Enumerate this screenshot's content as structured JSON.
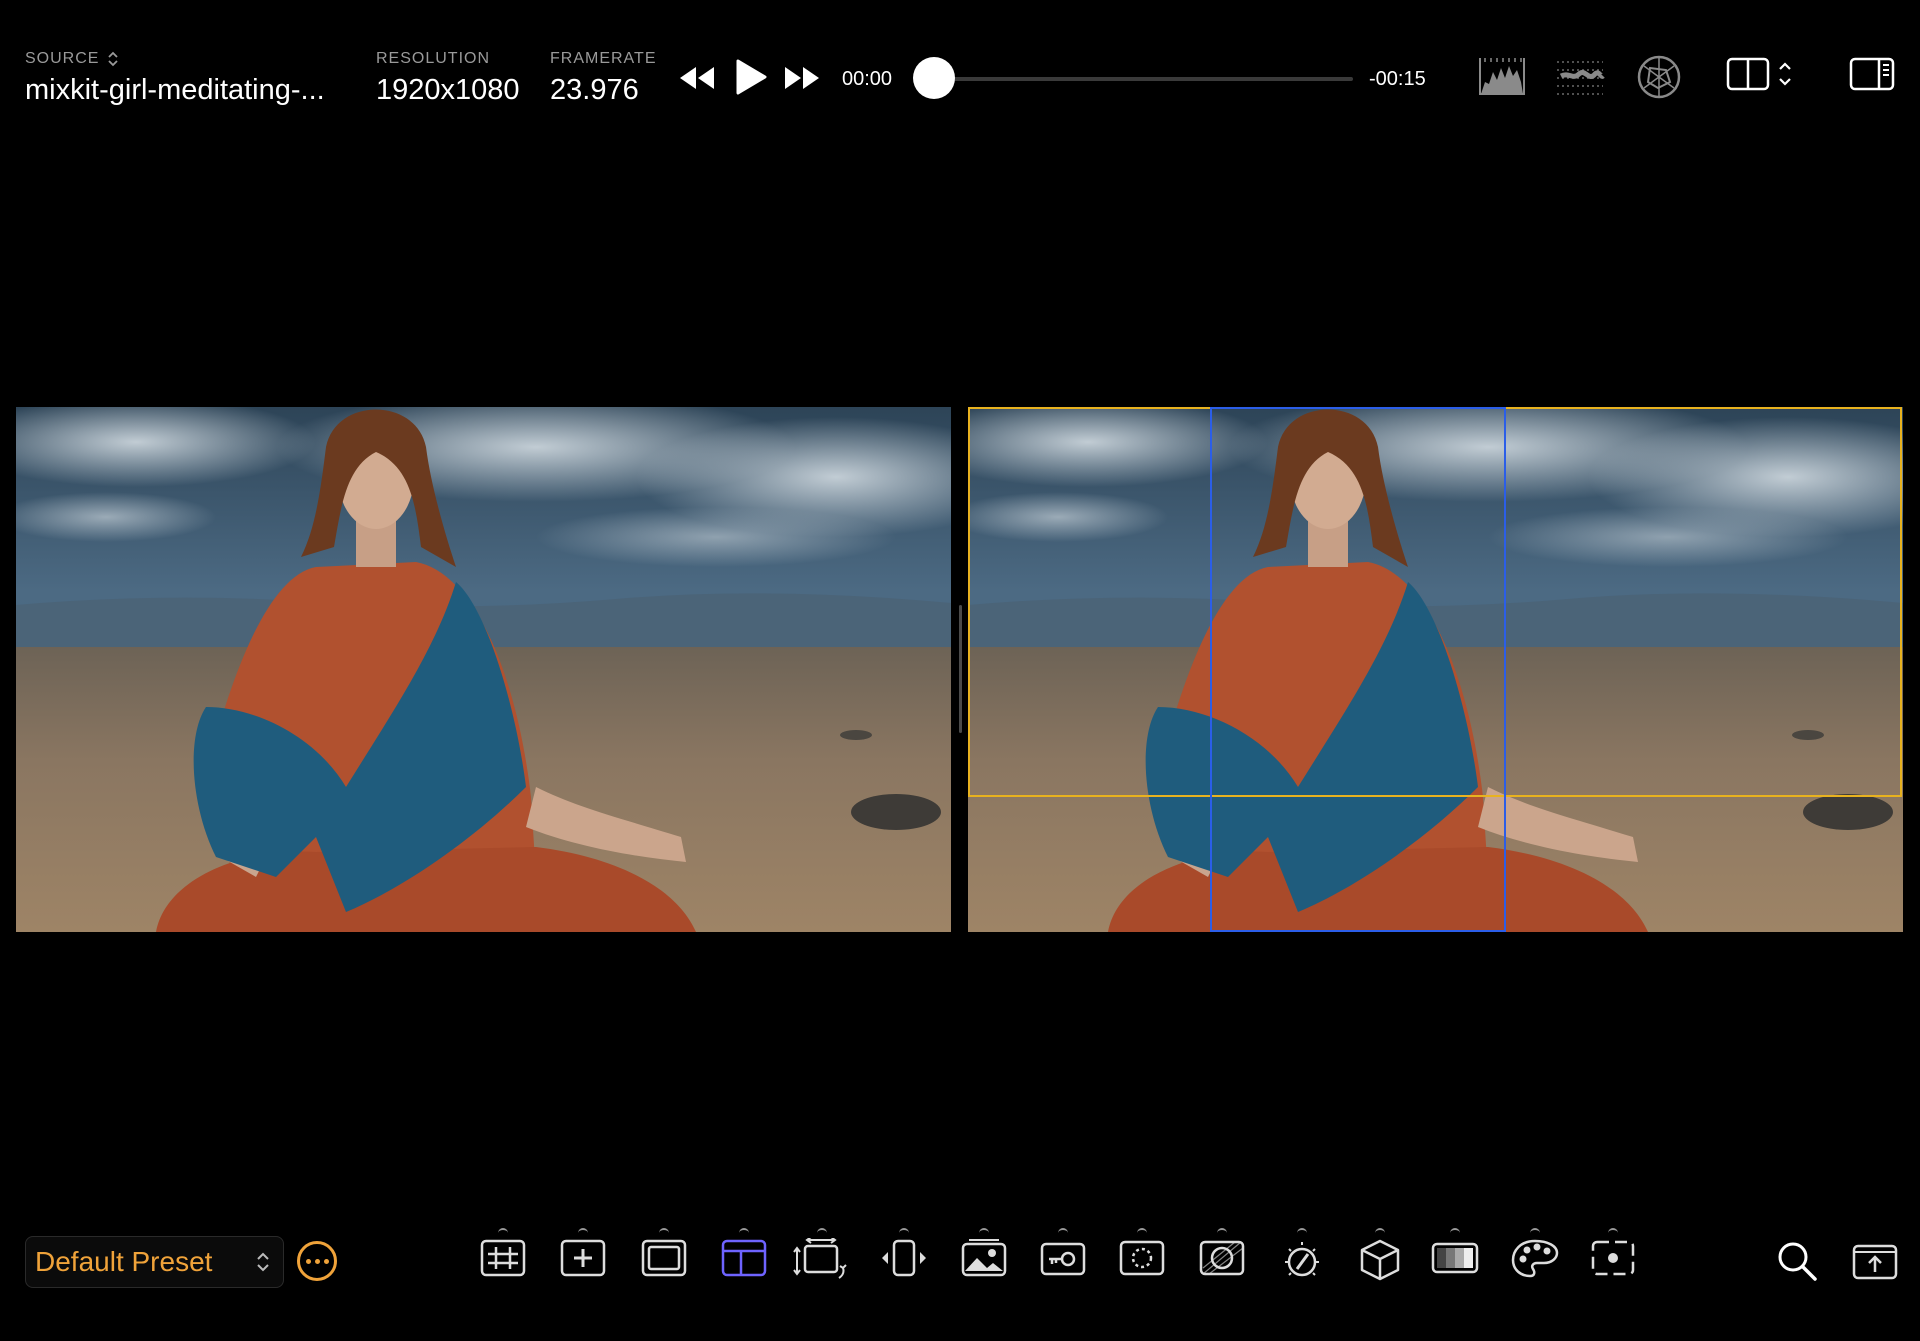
{
  "source": {
    "label": "SOURCE",
    "value": "mixkit-girl-meditating-..."
  },
  "resolution": {
    "label": "RESOLUTION",
    "value": "1920x1080"
  },
  "framerate": {
    "label": "FRAMERATE",
    "value": "23.976"
  },
  "playback": {
    "current_time": "00:00",
    "remaining_time": "-00:15",
    "progress": 0
  },
  "top_tools": [
    "histogram-icon",
    "waveform-icon",
    "vectorscope-icon",
    "split-view-icon",
    "sidebar-toggle-icon"
  ],
  "preset": {
    "name": "Default Preset"
  },
  "bottom_tools": [
    "grid-overlay-icon",
    "add-marker-icon",
    "frame-guide-icon",
    "safe-area-icon",
    "transform-icon",
    "flip-icon",
    "image-overlay-icon",
    "key-icon",
    "mask-icon",
    "exposure-icon",
    "dial-icon",
    "lut-cube-icon",
    "gradient-icon",
    "color-palette-icon",
    "focus-point-icon"
  ],
  "active_tool": "safe-area-icon",
  "colors": {
    "accent_orange": "#f0a33a",
    "active_tool": "#6e63ff",
    "frame_box": "#e8b21f",
    "crop_box": "#2b5ee8"
  }
}
